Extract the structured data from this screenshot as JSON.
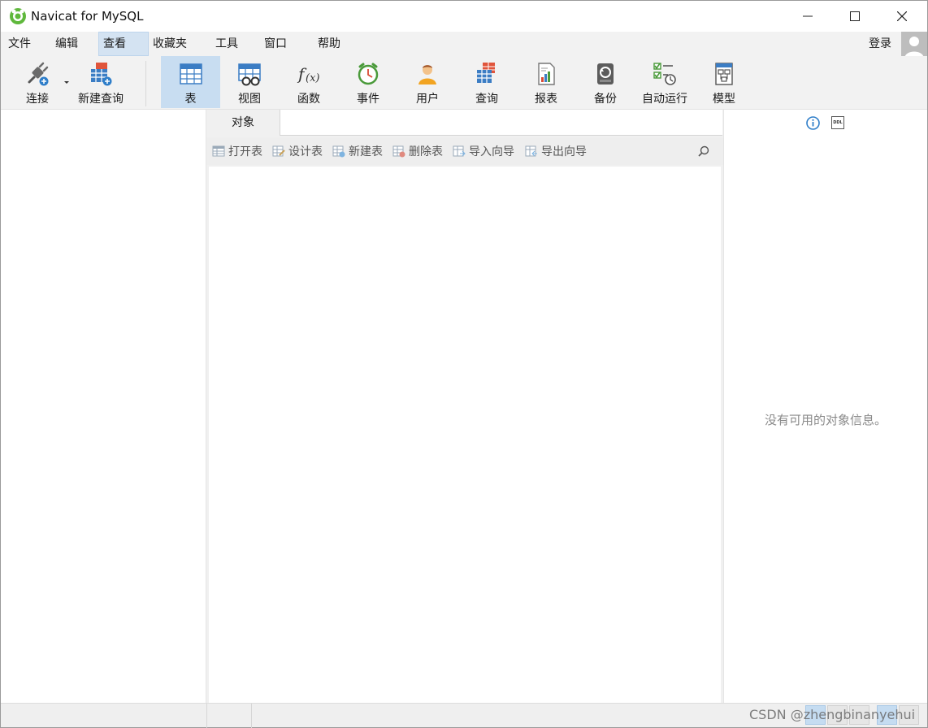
{
  "window": {
    "title": "Navicat for MySQL",
    "colors": {
      "accent": "#c8ddf1",
      "menu_active": "#d4e3f2",
      "toolbar_bg": "#f2f2f2"
    }
  },
  "menu": {
    "items": [
      {
        "label": "文件"
      },
      {
        "label": "编辑"
      },
      {
        "label": "查看",
        "active": true
      },
      {
        "label": "收藏夹"
      },
      {
        "label": "工具"
      },
      {
        "label": "窗口"
      },
      {
        "label": "帮助"
      }
    ],
    "login_label": "登录"
  },
  "toolbar": {
    "items": [
      {
        "label": "连接",
        "icon": "plug-connection-icon"
      },
      {
        "label": "新建查询",
        "icon": "new-query-icon"
      },
      {
        "label": "表",
        "icon": "table-icon",
        "active": true
      },
      {
        "label": "视图",
        "icon": "view-glasses-icon"
      },
      {
        "label": "函数",
        "icon": "function-fx-icon"
      },
      {
        "label": "事件",
        "icon": "alarm-clock-icon"
      },
      {
        "label": "用户",
        "icon": "user-icon"
      },
      {
        "label": "查询",
        "icon": "query-table-icon"
      },
      {
        "label": "报表",
        "icon": "report-icon"
      },
      {
        "label": "备份",
        "icon": "backup-icon"
      },
      {
        "label": "自动运行",
        "icon": "auto-run-icon"
      },
      {
        "label": "模型",
        "icon": "model-icon"
      }
    ]
  },
  "center": {
    "tab_label": "对象",
    "object_actions": [
      {
        "label": "打开表",
        "icon": "open-table-icon"
      },
      {
        "label": "设计表",
        "icon": "design-table-icon"
      },
      {
        "label": "新建表",
        "icon": "new-table-icon"
      },
      {
        "label": "删除表",
        "icon": "delete-table-icon"
      },
      {
        "label": "导入向导",
        "icon": "import-wizard-icon"
      },
      {
        "label": "导出向导",
        "icon": "export-wizard-icon"
      }
    ]
  },
  "right_panel": {
    "empty_message": "没有可用的对象信息。",
    "ddl_icon_text": "DDL"
  },
  "statusbar": {
    "watermark": "CSDN @zhengbinanyehui"
  }
}
